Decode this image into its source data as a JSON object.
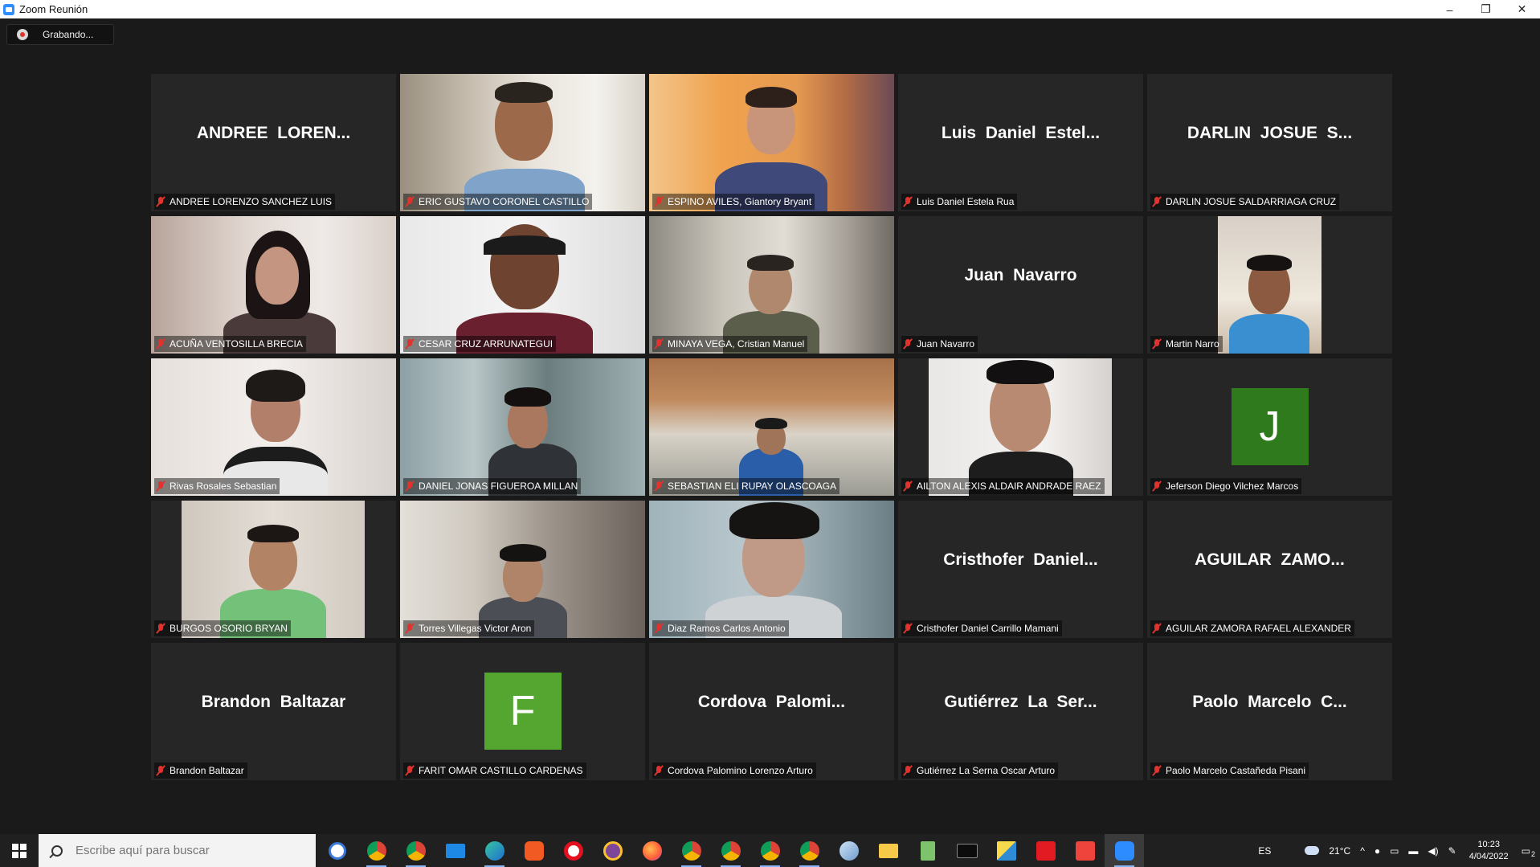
{
  "window": {
    "title": "Zoom Reunión",
    "minimize": "–",
    "restore": "❐",
    "close": "✕"
  },
  "recording": {
    "label": "Grabando..."
  },
  "tiles": [
    {
      "display": "ANDREE  LOREN...",
      "name": "ANDREE LORENZO SANCHEZ LUIS"
    },
    {
      "name": "ERIC GUSTAVO CORONEL CASTILLO",
      "speaking": true
    },
    {
      "name": "ESPINO AVILES, Giantory Bryant"
    },
    {
      "display": "Luis  Daniel  Estel...",
      "name": "Luis Daniel Estela Rua"
    },
    {
      "display": "DARLIN  JOSUE  S...",
      "name": "DARLIN JOSUE SALDARRIAGA CRUZ"
    },
    {
      "name": "ACUÑA VENTOSILLA BRECIA"
    },
    {
      "name": "CESAR CRUZ ARRUNATEGUI"
    },
    {
      "name": "MINAYA VEGA, Cristian Manuel"
    },
    {
      "display": "Juan  Navarro",
      "name": "Juan Navarro"
    },
    {
      "name": "Martin Narro"
    },
    {
      "name": "Rivas Rosales Sebastian"
    },
    {
      "name": "DANIEL JONAS FIGUEROA MILLAN"
    },
    {
      "name": "SEBASTIAN ELI RUPAY OLASCOAGA"
    },
    {
      "name": "AILTON ALEXIS ALDAIR ANDRADE RAEZ"
    },
    {
      "avatar": "J",
      "avatar_color": "#2f7a1d",
      "name": "Jeferson Diego Vilchez Marcos"
    },
    {
      "name": "BURGOS OSORIO BRYAN"
    },
    {
      "name": "Torres Villegas Victor Aron"
    },
    {
      "name": "Diaz Ramos Carlos Antonio"
    },
    {
      "display": "Cristhofer  Daniel...",
      "name": "Cristhofer Daniel Carrillo Mamani"
    },
    {
      "display": "AGUILAR  ZAMO...",
      "name": "AGUILAR ZAMORA RAFAEL ALEXANDER"
    },
    {
      "display": "Brandon  Baltazar",
      "name": "Brandon Baltazar"
    },
    {
      "avatar": "F",
      "avatar_color": "#55a630",
      "name": "FARIT OMAR CASTILLO CARDENAS"
    },
    {
      "display": "Cordova  Palomi...",
      "name": "Cordova Palomino Lorenzo Arturo"
    },
    {
      "display": "Gutiérrez  La  Ser...",
      "name": "Gutiérrez La Serna Oscar Arturo"
    },
    {
      "display": "Paolo  Marcelo  C...",
      "name": "Paolo Marcelo Castañeda Pisani"
    }
  ],
  "taskbar": {
    "search_placeholder": "Escribe aquí para buscar",
    "apps": [
      "cortana-icon",
      "chrome-icon",
      "chrome-icon",
      "mail-icon",
      "edge-icon",
      "brave-icon",
      "opera-icon",
      "tor-icon",
      "firefox-icon",
      "chrome-icon",
      "chrome-icon",
      "chrome-icon",
      "chrome-icon",
      "app-icon",
      "file-explorer-icon",
      "notepad-icon",
      "terminal-icon",
      "sticky-notes-icon",
      "acrobat-icon",
      "anydesk-icon",
      "zoom-icon"
    ],
    "language": "ES",
    "weather": "21°C",
    "time": "10:23",
    "date": "4/04/2022",
    "notifications": "2"
  }
}
